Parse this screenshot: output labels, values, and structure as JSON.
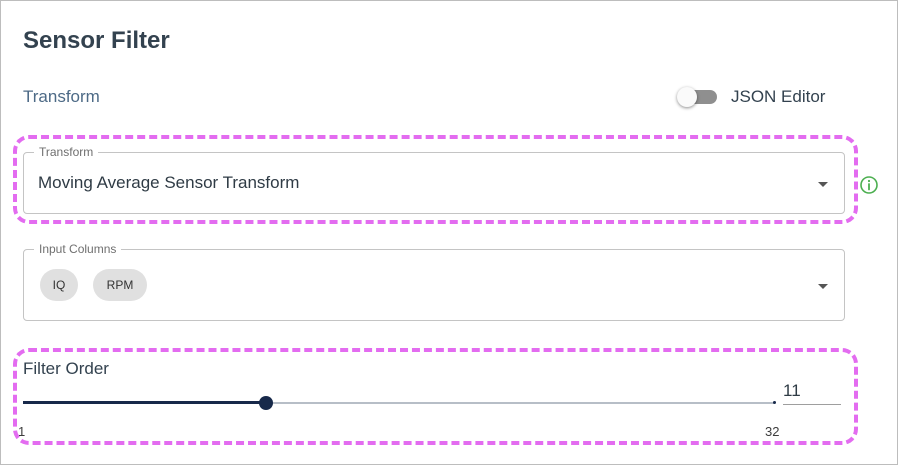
{
  "title": "Sensor Filter",
  "section_label": "Transform",
  "json_editor": {
    "label": "JSON Editor",
    "enabled": false
  },
  "transform": {
    "legend": "Transform",
    "value": "Moving Average Sensor Transform"
  },
  "input_columns": {
    "legend": "Input Columns",
    "chips": [
      "IQ",
      "RPM"
    ]
  },
  "filter_order": {
    "label": "Filter Order",
    "value": 11,
    "display_value": "11",
    "min": 1,
    "max": 32,
    "min_label": "1",
    "max_label": "32"
  },
  "colors": {
    "highlight": "#e36cf0",
    "slider": "#17294a",
    "info": "#4caf50",
    "label_blue": "#4d6a86"
  },
  "icons": {
    "info": "info-circle-icon",
    "dropdown": "chevron-down-icon"
  }
}
